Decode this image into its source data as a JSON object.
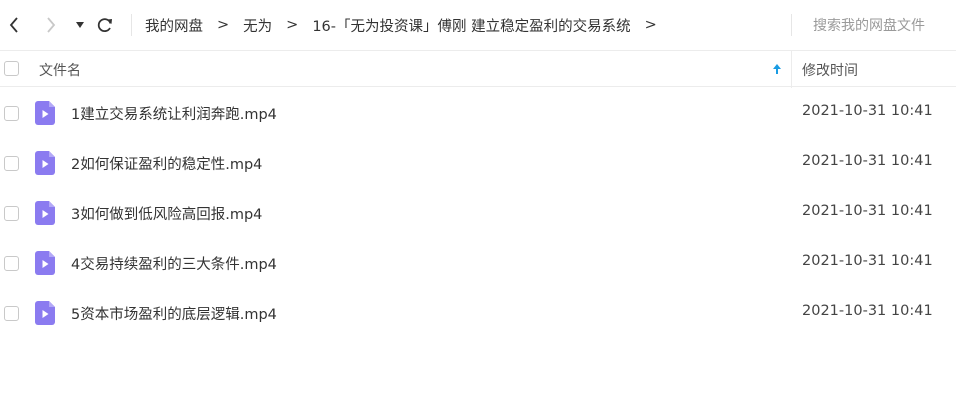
{
  "toolbar": {
    "back_icon": "chevron-left-icon",
    "forward_icon": "chevron-right-icon",
    "history_icon": "caret-down-icon",
    "refresh_icon": "refresh-icon",
    "breadcrumbs": [
      "我的网盘",
      "无为",
      "16-「无为投资课」傅刚 建立稳定盈利的交易系统"
    ],
    "separator": ">",
    "search_placeholder": "搜索我的网盘文件"
  },
  "table": {
    "col_name": "文件名",
    "col_time": "修改时间",
    "sort_icon": "arrow-up-icon"
  },
  "files": [
    {
      "name": "1建立交易系统让利润奔跑.mp4",
      "time": "2021-10-31 10:41"
    },
    {
      "name": "2如何保证盈利的稳定性.mp4",
      "time": "2021-10-31 10:41"
    },
    {
      "name": "3如何做到低风险高回报.mp4",
      "time": "2021-10-31 10:41"
    },
    {
      "name": "4交易持续盈利的三大条件.mp4",
      "time": "2021-10-31 10:41"
    },
    {
      "name": "5资本市场盈利的底层逻辑.mp4",
      "time": "2021-10-31 10:41"
    }
  ],
  "colors": {
    "video_icon": "#8b7bf0",
    "sort_arrow": "#1a9ce3"
  }
}
